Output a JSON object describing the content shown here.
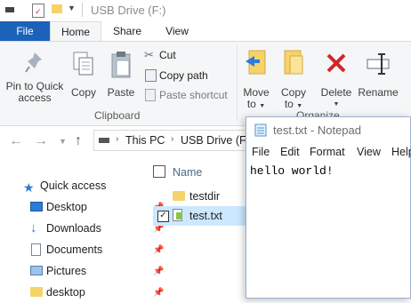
{
  "window": {
    "title": "USB Drive (F:)"
  },
  "tabs": [
    {
      "label": "File"
    },
    {
      "label": "Home"
    },
    {
      "label": "Share"
    },
    {
      "label": "View"
    }
  ],
  "ribbon": {
    "clipboard": {
      "pin_label_1": "Pin to Quick",
      "pin_label_2": "access",
      "copy": "Copy",
      "paste": "Paste",
      "cut": "Cut",
      "copy_path": "Copy path",
      "paste_shortcut": "Paste shortcut",
      "group": "Clipboard"
    },
    "organize": {
      "move_1": "Move",
      "move_2": "to",
      "copy_1": "Copy",
      "copy_2": "to",
      "delete": "Delete",
      "rename": "Rename",
      "group": "Organize"
    }
  },
  "address": {
    "segments": [
      "This PC",
      "USB Drive (F:"
    ]
  },
  "nav_pane": {
    "items": [
      {
        "label": "Quick access"
      },
      {
        "label": "Desktop"
      },
      {
        "label": "Downloads"
      },
      {
        "label": "Documents"
      },
      {
        "label": "Pictures"
      },
      {
        "label": "desktop"
      }
    ]
  },
  "file_list": {
    "column_name": "Name",
    "rows": [
      {
        "name": "testdir"
      },
      {
        "name": "test.txt"
      }
    ]
  },
  "notepad": {
    "title": "test.txt - Notepad",
    "menu": [
      "File",
      "Edit",
      "Format",
      "View",
      "Help"
    ],
    "content": "hello world!"
  },
  "colors": {
    "accent": "#1c62b9",
    "selection": "#cce8ff",
    "folder": "#f6d26b"
  }
}
